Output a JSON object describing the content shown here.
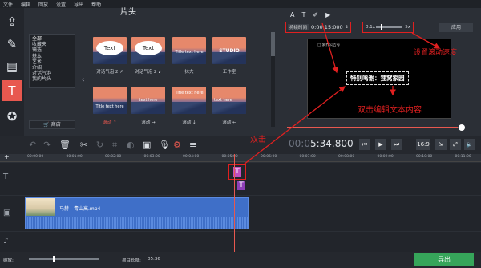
{
  "menu": [
    "文件",
    "编辑",
    "回放",
    "设置",
    "导出",
    "帮助"
  ],
  "panel": {
    "title": "片头",
    "store_label": "商店"
  },
  "categories": [
    "全部",
    "收藏夹",
    "镜选",
    "基本",
    "艺术",
    "介绍",
    "对话气泡",
    "我的片头"
  ],
  "thumbs": [
    {
      "text": "Text",
      "caption": "对话气泡 2 ↗"
    },
    {
      "text": "Text",
      "caption": "对话气泡 2 ↙"
    },
    {
      "text": "Title text here",
      "caption": "抹大"
    },
    {
      "text": "STUDIO",
      "caption": "工作室"
    },
    {
      "text": "Title text here",
      "caption": "滚动 ↑"
    },
    {
      "text": "text here",
      "caption": "滚动 →"
    },
    {
      "text": "Title text here",
      "caption": "滚动 ↓"
    },
    {
      "text": "text here",
      "caption": "滚动 ←"
    }
  ],
  "settings": {
    "duration_label": "持续时间",
    "duration_value": "0:00:15:000",
    "speed_min": "0.1x",
    "speed_max": "5x",
    "speed_value": 0.2,
    "apply_label": "应用"
  },
  "preview": {
    "logo": "□ 紫界公告号",
    "text": "特别鸣谢：狸窝家园",
    "progress": 0.96
  },
  "timeline": {
    "timecode_dim": "00:0",
    "timecode": "5:34.800",
    "ratio": "16:9",
    "ticks": [
      "00:00:00",
      "00:01:00",
      "00:02:00",
      "00:03:00",
      "00:04:00",
      "00:05:00",
      "00:06:00",
      "00:07:00",
      "00:08:00",
      "00:09:00",
      "00:10:00",
      "00:11:00"
    ],
    "clip_name": "马赫 - 青山高.mp4",
    "title_clip_letter": "T"
  },
  "status": {
    "zoom_label": "缩放:",
    "length_label": "项目长度:",
    "length_value": "05:36",
    "export_label": "导出"
  },
  "annotations": {
    "speed": "设置滚动速度",
    "edit": "双击编辑文本内容",
    "double_click": "双击"
  },
  "colors": {
    "accent": "#e8584f",
    "annotation": "#e02020",
    "export": "#36a55a",
    "clip": "#3f6fc8"
  }
}
